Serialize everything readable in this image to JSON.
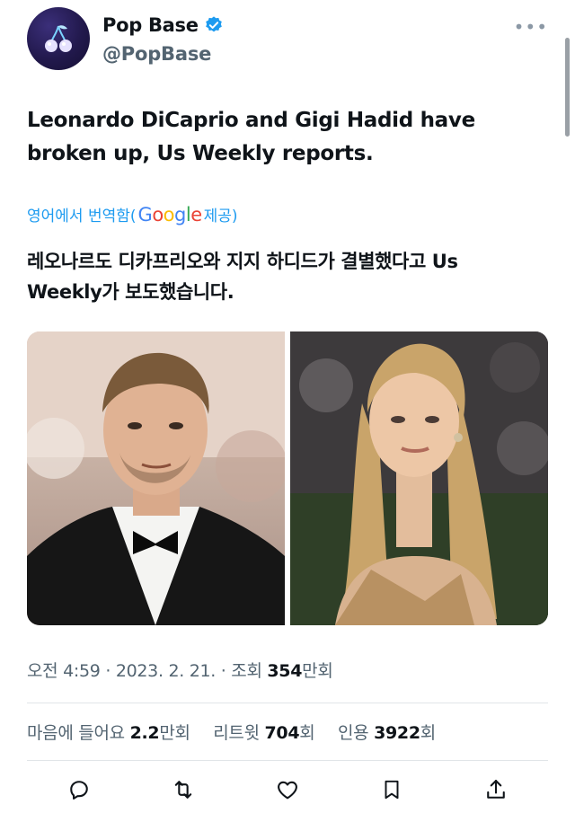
{
  "account": {
    "display_name": "Pop Base",
    "handle": "@PopBase",
    "avatar_icon": "cherry-icon",
    "verified_color": "#1d9bf0"
  },
  "tweet": {
    "text": "Leonardo DiCaprio and Gigi Hadid have broken up, Us Weekly reports.",
    "translate_prefix": "영어에서 번역함(",
    "translate_provider": "Google",
    "translate_suffix": " 제공)",
    "translated_text": "레오나르도 디카프리오와 지지 하디드가 결별했다고 Us Weekly가 보도했습니다."
  },
  "meta": {
    "time": "오전 4:59",
    "date": "2023. 2. 21.",
    "views_label": "조회",
    "views_value": "354",
    "views_unit": "만회"
  },
  "stats": {
    "likes_label": "마음에 들어요",
    "likes_value": "2.2",
    "likes_unit": "만회",
    "retweets_label": "리트윗",
    "retweets_value": "704",
    "retweets_unit": "회",
    "quotes_label": "인용",
    "quotes_value": "3922",
    "quotes_unit": "회"
  },
  "actions": [
    "reply-icon",
    "retweet-icon",
    "like-icon",
    "bookmark-icon",
    "share-icon"
  ],
  "colors": {
    "accent": "#1d9bf0",
    "text": "#0f1419",
    "secondary": "#536471"
  }
}
